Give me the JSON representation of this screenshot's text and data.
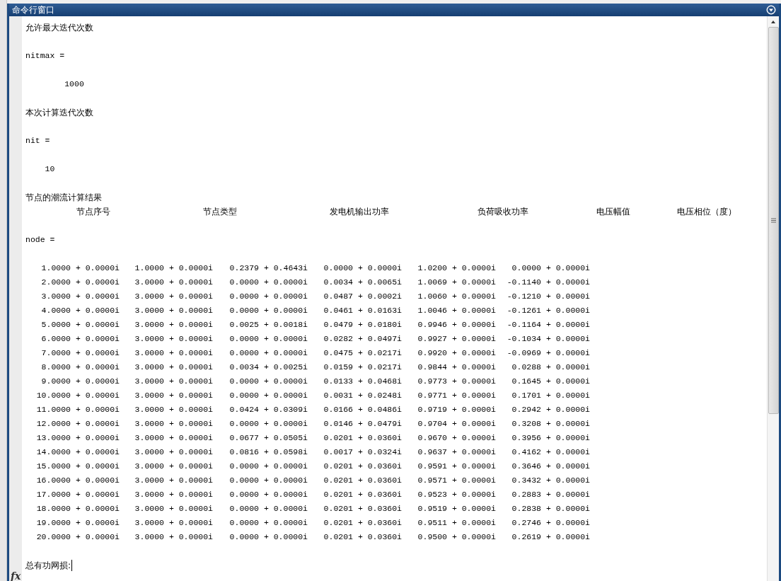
{
  "window": {
    "title": "命令行窗口"
  },
  "output": [
    {
      "kind": "text",
      "text": "允许最大迭代次数"
    },
    {
      "kind": "assign",
      "text": "nitmax ="
    },
    {
      "kind": "value",
      "text": "1000"
    },
    {
      "kind": "text",
      "text": "本次计算迭代次数"
    },
    {
      "kind": "assign",
      "text": "nit ="
    },
    {
      "kind": "value",
      "text": "10"
    },
    {
      "kind": "text",
      "text": "节点的潮流计算结果"
    }
  ],
  "heading_line": [
    "节点序号",
    "节点类型",
    "发电机输出功率",
    "负荷吸收功率",
    "电压幅值",
    "电压相位（度）"
  ],
  "matrix": {
    "variable": "node =",
    "rows": [
      [
        "1.0000 + 0.0000i",
        "1.0000 + 0.0000i",
        "0.2379 + 0.4643i",
        "0.0000 + 0.0000i",
        "1.0200 + 0.0000i",
        "0.0000 + 0.0000i"
      ],
      [
        "2.0000 + 0.0000i",
        "3.0000 + 0.0000i",
        "0.0000 + 0.0000i",
        "0.0034 + 0.0065i",
        "1.0069 + 0.0000i",
        "-0.1140 + 0.0000i"
      ],
      [
        "3.0000 + 0.0000i",
        "3.0000 + 0.0000i",
        "0.0000 + 0.0000i",
        "0.0487 + 0.0002i",
        "1.0060 + 0.0000i",
        "-0.1210 + 0.0000i"
      ],
      [
        "4.0000 + 0.0000i",
        "3.0000 + 0.0000i",
        "0.0000 + 0.0000i",
        "0.0461 + 0.0163i",
        "1.0046 + 0.0000i",
        "-0.1261 + 0.0000i"
      ],
      [
        "5.0000 + 0.0000i",
        "3.0000 + 0.0000i",
        "0.0025 + 0.0018i",
        "0.0479 + 0.0180i",
        "0.9946 + 0.0000i",
        "-0.1164 + 0.0000i"
      ],
      [
        "6.0000 + 0.0000i",
        "3.0000 + 0.0000i",
        "0.0000 + 0.0000i",
        "0.0282 + 0.0497i",
        "0.9927 + 0.0000i",
        "-0.1034 + 0.0000i"
      ],
      [
        "7.0000 + 0.0000i",
        "3.0000 + 0.0000i",
        "0.0000 + 0.0000i",
        "0.0475 + 0.0217i",
        "0.9920 + 0.0000i",
        "-0.0969 + 0.0000i"
      ],
      [
        "8.0000 + 0.0000i",
        "3.0000 + 0.0000i",
        "0.0034 + 0.0025i",
        "0.0159 + 0.0217i",
        "0.9844 + 0.0000i",
        "0.0288 + 0.0000i"
      ],
      [
        "9.0000 + 0.0000i",
        "3.0000 + 0.0000i",
        "0.0000 + 0.0000i",
        "0.0133 + 0.0468i",
        "0.9773 + 0.0000i",
        "0.1645 + 0.0000i"
      ],
      [
        "10.0000 + 0.0000i",
        "3.0000 + 0.0000i",
        "0.0000 + 0.0000i",
        "0.0031 + 0.0248i",
        "0.9771 + 0.0000i",
        "0.1701 + 0.0000i"
      ],
      [
        "11.0000 + 0.0000i",
        "3.0000 + 0.0000i",
        "0.0424 + 0.0309i",
        "0.0166 + 0.0486i",
        "0.9719 + 0.0000i",
        "0.2942 + 0.0000i"
      ],
      [
        "12.0000 + 0.0000i",
        "3.0000 + 0.0000i",
        "0.0000 + 0.0000i",
        "0.0146 + 0.0479i",
        "0.9704 + 0.0000i",
        "0.3208 + 0.0000i"
      ],
      [
        "13.0000 + 0.0000i",
        "3.0000 + 0.0000i",
        "0.0677 + 0.0505i",
        "0.0201 + 0.0360i",
        "0.9670 + 0.0000i",
        "0.3956 + 0.0000i"
      ],
      [
        "14.0000 + 0.0000i",
        "3.0000 + 0.0000i",
        "0.0816 + 0.0598i",
        "0.0017 + 0.0324i",
        "0.9637 + 0.0000i",
        "0.4162 + 0.0000i"
      ],
      [
        "15.0000 + 0.0000i",
        "3.0000 + 0.0000i",
        "0.0000 + 0.0000i",
        "0.0201 + 0.0360i",
        "0.9591 + 0.0000i",
        "0.3646 + 0.0000i"
      ],
      [
        "16.0000 + 0.0000i",
        "3.0000 + 0.0000i",
        "0.0000 + 0.0000i",
        "0.0201 + 0.0360i",
        "0.9571 + 0.0000i",
        "0.3432 + 0.0000i"
      ],
      [
        "17.0000 + 0.0000i",
        "3.0000 + 0.0000i",
        "0.0000 + 0.0000i",
        "0.0201 + 0.0360i",
        "0.9523 + 0.0000i",
        "0.2883 + 0.0000i"
      ],
      [
        "18.0000 + 0.0000i",
        "3.0000 + 0.0000i",
        "0.0000 + 0.0000i",
        "0.0201 + 0.0360i",
        "0.9519 + 0.0000i",
        "0.2838 + 0.0000i"
      ],
      [
        "19.0000 + 0.0000i",
        "3.0000 + 0.0000i",
        "0.0000 + 0.0000i",
        "0.0201 + 0.0360i",
        "0.9511 + 0.0000i",
        "0.2746 + 0.0000i"
      ],
      [
        "20.0000 + 0.0000i",
        "3.0000 + 0.0000i",
        "0.0000 + 0.0000i",
        "0.0201 + 0.0360i",
        "0.9500 + 0.0000i",
        "0.2619 + 0.0000i"
      ]
    ]
  },
  "prompt": {
    "text": "总有功网损:"
  },
  "prompt_icon": "fx"
}
